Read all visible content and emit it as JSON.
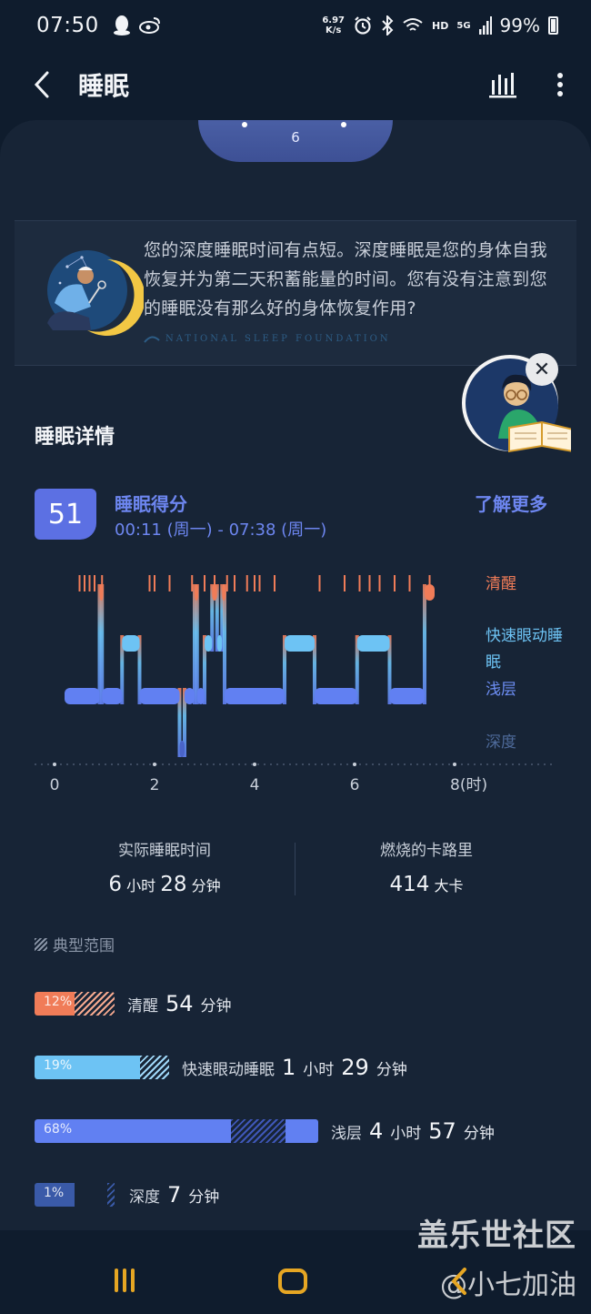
{
  "status_bar": {
    "time": "07:50",
    "speed_value": "6.97",
    "speed_unit": "K/s",
    "network": "HD",
    "signal": "5G",
    "battery": "99%",
    "left_icons": [
      "qq-icon",
      "weibo-icon"
    ],
    "right_icons": [
      "alarm-icon",
      "bluetooth-icon",
      "wifi-icon",
      "signal-icon",
      "battery-icon"
    ]
  },
  "app_bar": {
    "title": "睡眠"
  },
  "hero": {
    "number": "6"
  },
  "tip": {
    "text": "您的深度睡眠时间有点短。深度睡眠是您的身体自我恢复并为第二天积蓄能量的时间。您有没有注意到您的睡眠没有那么好的身体恢复作用?",
    "brand": "NATIONAL SLEEP FOUNDATION"
  },
  "details": {
    "section_title": "睡眠详情",
    "score": "51",
    "score_label": "睡眠得分",
    "time_range": "00:11 (周一) - 07:38 (周一)",
    "learn_more": "了解更多"
  },
  "chart_data": {
    "type": "hypnogram",
    "stages": [
      "清醒",
      "快速眼动睡眠",
      "浅层",
      "深度"
    ],
    "stage_colors": {
      "清醒": "#f07c58",
      "快速眼动睡眠": "#6dc3f4",
      "浅层": "#6180f2",
      "深度": "#4a64c8"
    },
    "x_ticks": [
      "0",
      "2",
      "4",
      "6",
      "8(时)"
    ],
    "xlim": [
      0,
      8
    ],
    "segments": [
      {
        "stage": "浅层",
        "start": 0.2,
        "end": 0.9
      },
      {
        "stage": "清醒",
        "start": 0.9,
        "end": 0.95
      },
      {
        "stage": "浅层",
        "start": 0.95,
        "end": 1.35
      },
      {
        "stage": "快速眼动睡眠",
        "start": 1.35,
        "end": 1.7
      },
      {
        "stage": "浅层",
        "start": 1.7,
        "end": 2.5
      },
      {
        "stage": "深度",
        "start": 2.5,
        "end": 2.6
      },
      {
        "stage": "浅层",
        "start": 2.6,
        "end": 2.8
      },
      {
        "stage": "清醒",
        "start": 2.8,
        "end": 2.85
      },
      {
        "stage": "浅层",
        "start": 2.85,
        "end": 3.0
      },
      {
        "stage": "快速眼动睡眠",
        "start": 3.0,
        "end": 3.15
      },
      {
        "stage": "清醒",
        "start": 3.15,
        "end": 3.25
      },
      {
        "stage": "快速眼动睡眠",
        "start": 3.25,
        "end": 3.35
      },
      {
        "stage": "清醒",
        "start": 3.35,
        "end": 3.4
      },
      {
        "stage": "浅层",
        "start": 3.4,
        "end": 4.6
      },
      {
        "stage": "快速眼动睡眠",
        "start": 4.6,
        "end": 5.2
      },
      {
        "stage": "浅层",
        "start": 5.2,
        "end": 6.05
      },
      {
        "stage": "快速眼动睡眠",
        "start": 6.05,
        "end": 6.7
      },
      {
        "stage": "浅层",
        "start": 6.7,
        "end": 7.4
      },
      {
        "stage": "清醒",
        "start": 7.4,
        "end": 7.6
      }
    ],
    "awake_ticks": [
      0.5,
      0.6,
      0.7,
      0.8,
      0.95,
      1.9,
      2.0,
      2.3,
      2.75,
      3.0,
      3.2,
      3.45,
      3.6,
      3.85,
      4.0,
      4.1,
      4.4,
      5.3,
      5.8,
      6.1,
      6.3,
      6.5,
      6.8,
      7.1,
      7.5
    ]
  },
  "stats": {
    "actual_sleep_label": "实际睡眠时间",
    "actual_sleep_h": "6",
    "actual_sleep_h_unit": "小时",
    "actual_sleep_m": "28",
    "actual_sleep_m_unit": "分钟",
    "calories_label": "燃烧的卡路里",
    "calories_value": "414",
    "calories_unit": "大卡"
  },
  "typical_range_label": "典型范围",
  "breakdown": [
    {
      "stage": "清醒",
      "percent": "12%",
      "fraction": 0.12,
      "color": "#f07c58",
      "hatch": "#f5a98f",
      "h": "",
      "h_unit": "",
      "m": "54",
      "m_unit": "分钟"
    },
    {
      "stage": "快速眼动睡眠",
      "percent": "19%",
      "fraction": 0.19,
      "color": "#6dc3f4",
      "hatch": "#9fd7f8",
      "h": "1",
      "h_unit": "小时",
      "m": "29",
      "m_unit": "分钟"
    },
    {
      "stage": "浅层",
      "percent": "68%",
      "fraction": 0.68,
      "color": "#6180f2",
      "hatch": "#3f57b8",
      "h": "4",
      "h_unit": "小时",
      "m": "57",
      "m_unit": "分钟"
    },
    {
      "stage": "深度",
      "percent": "1%",
      "fraction": 0.01,
      "color": "#3a5aa8",
      "hatch": "#3a5aa8",
      "h": "",
      "h_unit": "",
      "m": "7",
      "m_unit": "分钟"
    }
  ],
  "watermark": {
    "line1": "盖乐世社区",
    "line2": "@小七加油"
  }
}
